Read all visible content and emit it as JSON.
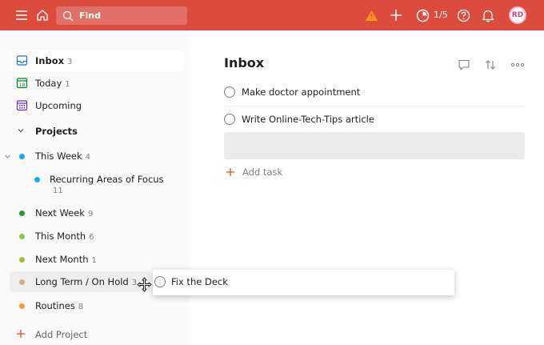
{
  "header": {
    "search_placeholder": "Find",
    "karma_progress": "1/5",
    "avatar_initials": "RD",
    "icons": [
      "menu-icon",
      "home-icon",
      "search-icon",
      "warning-icon",
      "plus-icon",
      "productivity-icon",
      "help-icon",
      "bell-icon"
    ]
  },
  "sidebar": {
    "nav": [
      {
        "label": "Inbox",
        "count": "3",
        "icon": "inbox-icon"
      },
      {
        "label": "Today",
        "count": "1",
        "icon": "calendar-today-icon"
      },
      {
        "label": "Upcoming",
        "count": "",
        "icon": "calendar-upcoming-icon"
      }
    ],
    "projects_header": "Projects",
    "projects": [
      {
        "label": "This Week",
        "count": "4",
        "color": "#14aaf5"
      },
      {
        "label": "Recurring Areas of Focus",
        "count": "11",
        "color": "#14aaf5"
      },
      {
        "label": "Next Week",
        "count": "9",
        "color": "#299438"
      },
      {
        "label": "This Month",
        "count": "6",
        "color": "#7ecc49"
      },
      {
        "label": "Next Month",
        "count": "1",
        "color": "#afb83b"
      },
      {
        "label": "Long Term / On Hold",
        "count": "3",
        "color": "#ccac93"
      },
      {
        "label": "Routines",
        "count": "8",
        "color": "#ff9933"
      }
    ],
    "add_project": "Add Project"
  },
  "main": {
    "title": "Inbox",
    "tasks": [
      "Make doctor appointment",
      "Write Online-Tech-Tips article"
    ],
    "add_task": "Add task",
    "dragging_task": "Fix the Deck"
  },
  "colors": {
    "brand": "#db4c3f",
    "warning": "#ff9a14"
  }
}
